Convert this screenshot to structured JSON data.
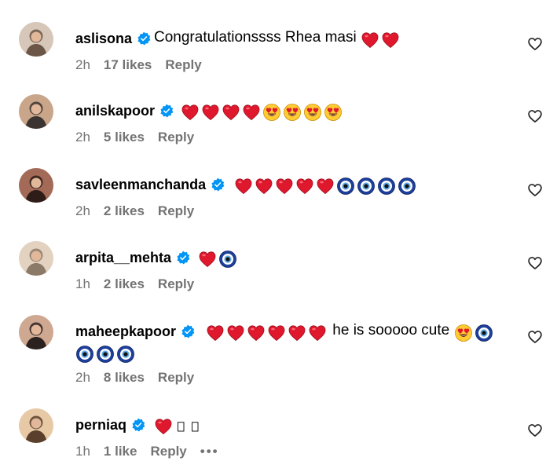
{
  "comments": [
    {
      "username": "aslisona",
      "text": "Congratulationssss Rhea masi",
      "emojis": [
        "heart",
        "heart"
      ],
      "emojis2": [],
      "time": "2h",
      "likes": "17 likes",
      "reply": "Reply",
      "avatar_colors": [
        "#6b5546",
        "#d6c7b8"
      ]
    },
    {
      "username": "anilskapoor",
      "text": "",
      "emojis": [
        "heart",
        "heart",
        "heart",
        "heart",
        "heart-eyes",
        "heart-eyes",
        "heart-eyes",
        "heart-eyes"
      ],
      "emojis2": [],
      "time": "2h",
      "likes": "5 likes",
      "reply": "Reply",
      "avatar_colors": [
        "#3b3430",
        "#c9a58a"
      ]
    },
    {
      "username": "savleenmanchanda",
      "text": "",
      "emojis": [
        "heart",
        "heart",
        "heart",
        "heart",
        "heart",
        "evil-eye",
        "evil-eye",
        "evil-eye",
        "evil-eye"
      ],
      "emojis2": [],
      "time": "2h",
      "likes": "2 likes",
      "reply": "Reply",
      "avatar_colors": [
        "#2e1c18",
        "#a36b57"
      ]
    },
    {
      "username": "arpita__mehta",
      "text": "",
      "emojis": [
        "heart",
        "evil-eye"
      ],
      "emojis2": [],
      "time": "1h",
      "likes": "2 likes",
      "reply": "Reply",
      "avatar_colors": [
        "#8c7a68",
        "#e2d2bf"
      ]
    },
    {
      "username": "maheepkapoor",
      "text": "he is sooooo cute",
      "emojis": [
        "heart",
        "heart",
        "heart",
        "heart",
        "heart",
        "heart"
      ],
      "emojis_after_text": [
        "heart-eyes",
        "evil-eye"
      ],
      "emojis2": [
        "evil-eye",
        "evil-eye",
        "evil-eye"
      ],
      "time": "2h",
      "likes": "8 likes",
      "reply": "Reply",
      "avatar_colors": [
        "#2b2220",
        "#cfa892"
      ]
    },
    {
      "username": "perniaq",
      "text": "",
      "emojis": [
        "heart",
        "missing-glyph",
        "missing-glyph"
      ],
      "emojis2": [],
      "time": "1h",
      "likes": "1 like",
      "reply": "Reply",
      "more": "•••",
      "avatar_colors": [
        "#5a3f2c",
        "#e7c9a6"
      ]
    }
  ],
  "icons": {
    "verified": "verified-badge-icon",
    "like": "heart-outline-icon",
    "more": "more-options-icon"
  },
  "colors": {
    "verified": "#0095f6",
    "meta": "#737373",
    "heart_emoji": "#e0182d",
    "evil_eye": "#1e3f9a"
  }
}
